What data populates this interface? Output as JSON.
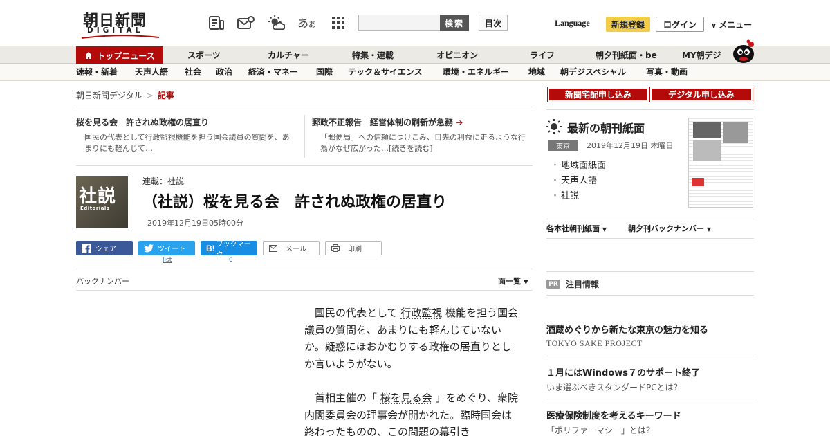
{
  "header": {
    "logo_main": "朝日新聞",
    "logo_sub": "DIGITAL",
    "icons": [
      "newspaper-icon",
      "mail-icon",
      "weather-icon",
      "font-size-icon",
      "apps-grid-icon"
    ],
    "font_size_label": "あ",
    "font_size_small": "あ",
    "search_placeholder": "",
    "search_button": "検索",
    "index_button": "目次",
    "language": "Language",
    "register": "新規登録",
    "login": "ログイン",
    "menu": "メニュー"
  },
  "nav_primary": {
    "top_news": "トップニュース",
    "items": [
      "スポーツ",
      "カルチャー",
      "特集・連載",
      "オピニオン",
      "ライフ",
      "朝夕刊紙面・be",
      "MY朝デジ"
    ]
  },
  "nav_secondary": {
    "items": [
      "速報・新着",
      "天声人語",
      "社会",
      "政治",
      "経済・マネー",
      "国際",
      "テック＆サイエンス",
      "環境・エネルギー",
      "地域",
      "朝デジスペシャル",
      "写真・動画"
    ]
  },
  "breadcrumb": {
    "home": "朝日新聞デジタル",
    "separator": ">",
    "current": "記事"
  },
  "related": [
    {
      "title": "桜を見る会　許されぬ政権の居直り",
      "text": "国民の代表として行政監視機能を担う国会議員の質問を、あまりにも軽んじて…"
    },
    {
      "title": "郵政不正報告　経営体制の刷新が急務",
      "text": "「郵便局」への信頼につけこみ、目先の利益に走るような行為がなぜ広がった…[続きを読む]"
    }
  ],
  "article": {
    "thumb_kanji": "社説",
    "thumb_en": "Editorials",
    "series": "連載：社説",
    "title": "（社説）桜を見る会　許されぬ政権の居直り",
    "date": "2019年12月19日05時00分",
    "share": {
      "facebook": "シェア",
      "twitter": "ツイート",
      "twitter_count": "list",
      "hatena": "ブックマーク",
      "hatena_count": "0",
      "mail": "メール",
      "print": "印刷"
    },
    "back_numbers": "バックナンバー",
    "list_all": "面一覧",
    "paragraphs": [
      {
        "pre": "国民の代表として ",
        "link": "行政監視",
        "post": " 機能を担う国会議員の質問を、あまりにも軽んじていないか。疑惑にほおかむりする政権の居直りとしか言いようがない。"
      },
      {
        "pre": "首相主催の「 ",
        "link": "桜を見る会",
        "post": " 」をめぐり、衆院内閣委員会の理事会が開かれた。臨時国会は終わったものの、この問題の幕引き"
      }
    ]
  },
  "sidebar": {
    "btn_home_delivery": "新聞宅配申し込み",
    "btn_digital": "デジタル申し込み",
    "paper_title": "最新の朝刊紙面",
    "paper_location": "東京",
    "paper_date": "2019年12月19日 木曜日",
    "paper_links": [
      "地域面紙面",
      "天声人語",
      "社説"
    ],
    "dropdown_1": "各本社朝刊紙面",
    "dropdown_2": "朝夕刊バックナンバー",
    "pr_badge": "PR",
    "pr_title": "注目情報",
    "ads": [
      {
        "title": "酒蔵めぐりから新たな東京の魅力を知る",
        "sub": "TOKYO SAKE PROJECT"
      },
      {
        "title": "１月にはWindows７のサポート終了",
        "sub": "いま選ぶべきスタンダードPCとは？"
      },
      {
        "title": "医療保険制度を考えるキーワード",
        "sub": "「ポリファーマシー」とは？"
      }
    ]
  },
  "colors": {
    "brand_red": "#b40a0a",
    "register_yellow": "#f3cd4a",
    "facebook": "#3b5998",
    "twitter": "#2aa3ef",
    "hatena": "#178ee3"
  }
}
